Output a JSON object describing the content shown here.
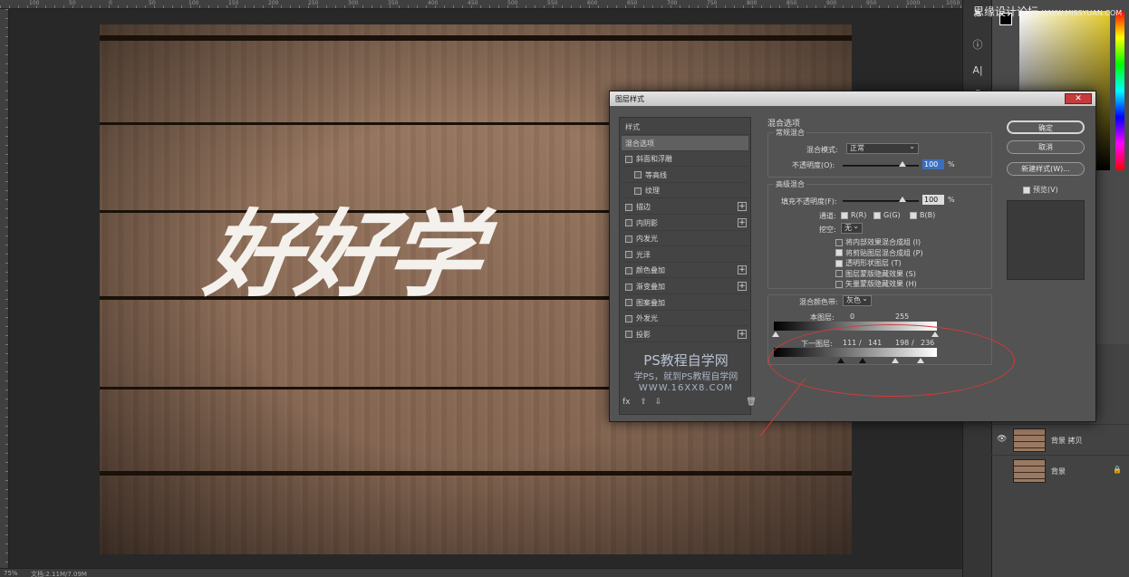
{
  "ruler": {
    "ticks": [
      "100",
      "50",
      "0",
      "50",
      "100",
      "150",
      "200",
      "250",
      "300",
      "350",
      "400",
      "450",
      "500",
      "550",
      "600",
      "650",
      "700",
      "750",
      "800",
      "850",
      "900",
      "950",
      "1000",
      "1050"
    ]
  },
  "canvas": {
    "text_art": "好好学"
  },
  "status": {
    "zoom": "75%",
    "doc": "文档:2.11M/7.09M"
  },
  "watermark_top": {
    "main": "思缘设计论坛",
    "sub": "WWW.MISSYUAN.COM"
  },
  "dialog": {
    "title": "图层样式",
    "close": "✕",
    "styles_list": [
      {
        "label": "样式",
        "type": "hdr"
      },
      {
        "label": "混合选项",
        "type": "sel"
      },
      {
        "label": "斜面和浮雕",
        "type": "chk"
      },
      {
        "label": "等高线",
        "type": "sub"
      },
      {
        "label": "纹理",
        "type": "sub"
      },
      {
        "label": "描边",
        "type": "chk",
        "plus": true
      },
      {
        "label": "内阴影",
        "type": "chk",
        "plus": true
      },
      {
        "label": "内发光",
        "type": "chk"
      },
      {
        "label": "光泽",
        "type": "chk"
      },
      {
        "label": "颜色叠加",
        "type": "chk",
        "plus": true
      },
      {
        "label": "渐变叠加",
        "type": "chk",
        "plus": true
      },
      {
        "label": "图案叠加",
        "type": "chk"
      },
      {
        "label": "外发光",
        "type": "chk"
      },
      {
        "label": "投影",
        "type": "chk",
        "plus": true
      }
    ],
    "watermark": {
      "line1": "PS教程自学网",
      "line2": "学PS，就到PS教程自学网",
      "line3": "WWW.16XX8.COM"
    },
    "fx": "fx",
    "section_title": "混合选项",
    "normal": {
      "title": "常规混合",
      "mode_label": "混合模式:",
      "mode_value": "正常",
      "opacity_label": "不透明度(O):",
      "opacity_value": "100",
      "pct": "%"
    },
    "advanced": {
      "title": "高级混合",
      "fill_label": "填充不透明度(F):",
      "fill_value": "100",
      "pct": "%",
      "channel_label": "通道:",
      "channels": [
        "R(R)",
        "G(G)",
        "B(B)"
      ],
      "knockout_label": "挖空:",
      "knockout_value": "无",
      "options": [
        {
          "label": "将内部效果混合成组 (I)",
          "on": false
        },
        {
          "label": "将剪贴图层混合成组 (P)",
          "on": true
        },
        {
          "label": "透明形状图层 (T)",
          "on": true
        },
        {
          "label": "图层蒙版隐藏效果 (S)",
          "on": false
        },
        {
          "label": "矢量蒙版隐藏效果 (H)",
          "on": false
        }
      ]
    },
    "blend_if": {
      "label": "混合颜色带:",
      "value": "灰色",
      "this_layer": "本图层:",
      "this_min": "0",
      "this_max": "255",
      "underlying": "下一图层:",
      "u1": "111",
      "sep1": "/",
      "u2": "141",
      "u3": "198",
      "sep2": "/",
      "u4": "236"
    },
    "buttons": {
      "ok": "确定",
      "cancel": "取消",
      "new_style": "新建样式(W)...",
      "preview": "预览(V)"
    }
  },
  "layers": [
    {
      "name": "背景 拷贝",
      "eye": "👁",
      "lock": ""
    },
    {
      "name": "背景",
      "eye": "",
      "lock": "🔒"
    }
  ],
  "colors": {
    "ellipse": "#d23a3a"
  }
}
